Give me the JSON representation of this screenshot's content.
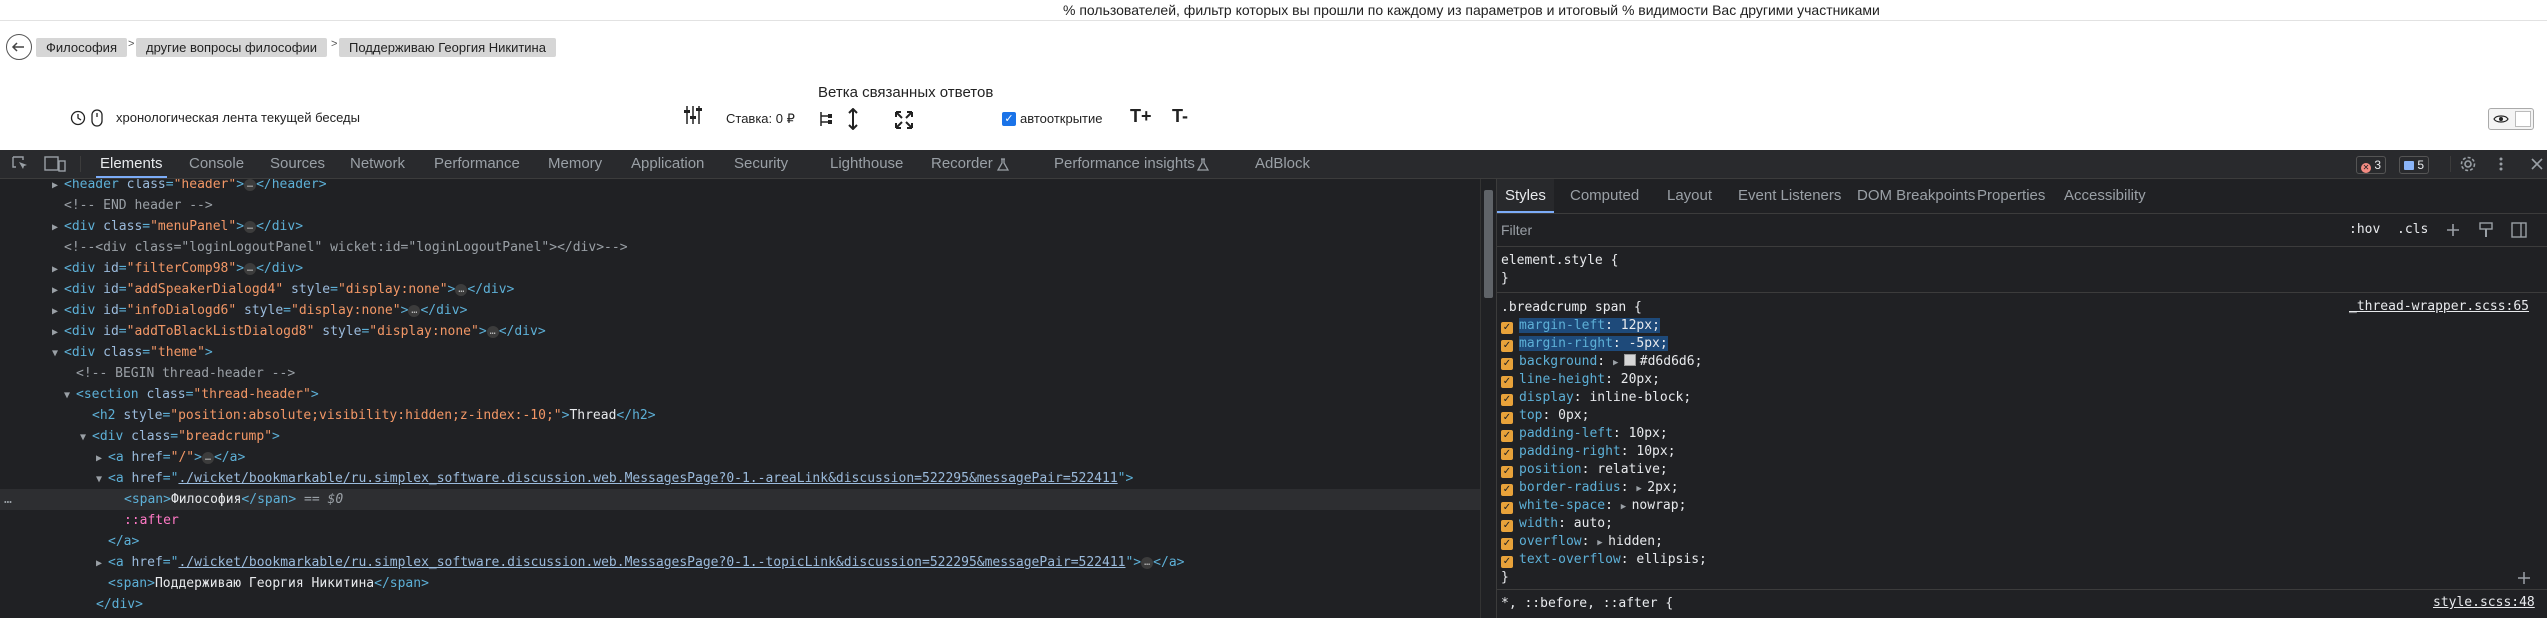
{
  "page": {
    "top_notice": "% пользователей, фильтр которых вы прошли по каждому из параметров и итоговый % видимости Вас другими участниками",
    "breadcrumb": [
      "Философия",
      "другие вопросы философии",
      "Поддерживаю Георгия Никитина"
    ],
    "breadcrumb_separator": ">",
    "thread_title": "Ветка связанных ответов",
    "timeline_label": "хронологическая лента текущей беседы",
    "stake_label": "Ставка: 0 ₽",
    "autoopen_label": "автооткрытие",
    "font_increase": "T+",
    "font_decrease": "T-"
  },
  "devtools": {
    "tabs": [
      "Elements",
      "Console",
      "Sources",
      "Network",
      "Performance",
      "Memory",
      "Application",
      "Security",
      "Lighthouse",
      "Recorder",
      "Performance insights",
      "AdBlock"
    ],
    "active_tab": "Elements",
    "error_count": "3",
    "message_count": "5",
    "elements": {
      "lines": [
        {
          "k": "l1"
        },
        {
          "k": "l2"
        },
        {
          "k": "l3"
        },
        {
          "k": "l4"
        },
        {
          "k": "l5"
        },
        {
          "k": "l6"
        },
        {
          "k": "l7"
        },
        {
          "k": "l8"
        },
        {
          "k": "l9"
        },
        {
          "k": "l10"
        },
        {
          "k": "l11"
        },
        {
          "k": "l12"
        },
        {
          "k": "l13"
        },
        {
          "k": "l14"
        },
        {
          "k": "l15"
        },
        {
          "k": "l16"
        },
        {
          "k": "l17"
        },
        {
          "k": "l18"
        },
        {
          "k": "l19"
        },
        {
          "k": "l20"
        },
        {
          "k": "l21"
        }
      ],
      "t": {
        "header_tag": "header",
        "class_attr": "class",
        "header_val": "\"header\"",
        "end_header_comment": "<!-- END header -->",
        "menu_panel_val": "\"menuPanel\"",
        "login_comment": "<!--<div class=\"loginLogoutPanel\" wicket:id=\"loginLogoutPanel\"></div>-->",
        "id_attr": "id",
        "style_attr": "style",
        "filter_val": "\"filterComp98\"",
        "add_speaker_val": "\"addSpeakerDialogd4\"",
        "info_dialog_val": "\"infoDialogd6\"",
        "add_blacklist_val": "\"addToBlackListDialogd8\"",
        "display_none_val": "\"display:none\"",
        "theme_val": "\"theme\"",
        "begin_thread_comment": "<!-- BEGIN thread-header -->",
        "thread_header_val": "\"thread-header\"",
        "h2_style_val": "\"position:absolute;visibility:hidden;z-index:-10;\"",
        "h2_text": "Thread",
        "breadcrump_val": "\"breadcrump\"",
        "href_attr": "href",
        "href_root": "\"/\"",
        "href_area": "./wicket/bookmarkable/ru.simplex_software.discussion.web.MessagesPage?0-1.-areaLink&discussion=522295&messagePair=522411",
        "span_text": "Философия",
        "selected_marker": "== $0",
        "after_pseudo": "::after",
        "href_topic": "./wicket/bookmarkable/ru.simplex_software.discussion.web.MessagesPage?0-1.-topicLink&discussion=522295&messagePair=522411",
        "span_text2": "Поддерживаю Георгия Никитина",
        "ellipsis": "…",
        "dots": "…"
      }
    },
    "styles": {
      "tabs": [
        "Styles",
        "Computed",
        "Layout",
        "Event Listeners",
        "DOM Breakpoints",
        "Properties",
        "Accessibility"
      ],
      "active_tab": "Styles",
      "filter_placeholder": "Filter",
      "hov": ":hov",
      "cls": ".cls",
      "element_style": "element.style {",
      "close_brace": "}",
      "rule_selector": ".breadcrump span {",
      "rule_source": "_thread-wrapper.scss:65",
      "declarations": [
        {
          "prop": "margin-left",
          "value": "12px",
          "highlight": true
        },
        {
          "prop": "margin-right",
          "value": "-5px",
          "highlight": true
        },
        {
          "prop": "background",
          "value": "#d6d6d6",
          "swatch": "#d6d6d6",
          "expand": true
        },
        {
          "prop": "line-height",
          "value": "20px"
        },
        {
          "prop": "display",
          "value": "inline-block"
        },
        {
          "prop": "top",
          "value": "0px"
        },
        {
          "prop": "padding-left",
          "value": "10px"
        },
        {
          "prop": "padding-right",
          "value": "10px"
        },
        {
          "prop": "position",
          "value": "relative"
        },
        {
          "prop": "border-radius",
          "value": "2px",
          "expand": true
        },
        {
          "prop": "white-space",
          "value": "nowrap",
          "expand": true
        },
        {
          "prop": "width",
          "value": "auto"
        },
        {
          "prop": "overflow",
          "value": "hidden",
          "expand": true
        },
        {
          "prop": "text-overflow",
          "value": "ellipsis"
        }
      ],
      "next_selector": "*, ::before, ::after {",
      "next_source": "style.scss:48"
    }
  }
}
